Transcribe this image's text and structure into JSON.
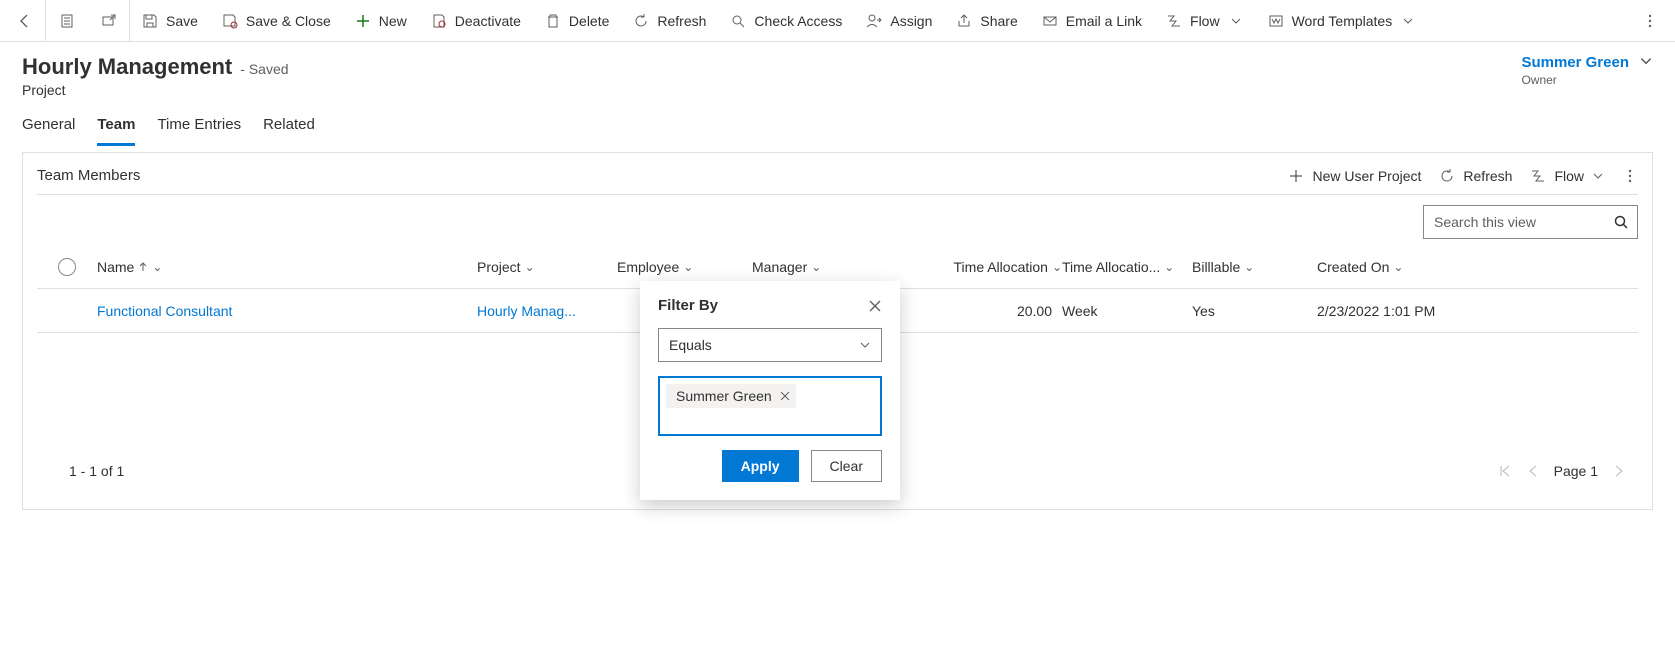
{
  "commandBar": {
    "save": "Save",
    "saveClose": "Save & Close",
    "new": "New",
    "deactivate": "Deactivate",
    "delete": "Delete",
    "refresh": "Refresh",
    "checkAccess": "Check Access",
    "assign": "Assign",
    "share": "Share",
    "emailLink": "Email a Link",
    "flow": "Flow",
    "wordTemplates": "Word Templates"
  },
  "header": {
    "title": "Hourly Management",
    "savedState": "- Saved",
    "entity": "Project",
    "ownerName": "Summer Green",
    "ownerLabel": "Owner"
  },
  "tabs": {
    "general": "General",
    "team": "Team",
    "timeEntries": "Time Entries",
    "related": "Related"
  },
  "subgrid": {
    "title": "Team Members",
    "actions": {
      "newUserProject": "New User Project",
      "refresh": "Refresh",
      "flow": "Flow"
    },
    "searchPlaceholder": "Search this view",
    "columns": {
      "name": "Name",
      "project": "Project",
      "employee": "Employee",
      "manager": "Manager",
      "timeAllocation": "Time Allocation",
      "timeAllocationUnit": "Time Allocatio...",
      "billable": "Billlable",
      "createdOn": "Created On"
    },
    "rows": [
      {
        "name": "Functional Consultant",
        "project": "Hourly Manag...",
        "employee": "",
        "manager": "",
        "timeAllocation": "20.00",
        "timeAllocationUnit": "Week",
        "billable": "Yes",
        "createdOn": "2/23/2022 1:01 PM"
      }
    ],
    "paging": {
      "range": "1 - 1 of 1",
      "pageLabel": "Page 1"
    }
  },
  "filterPopup": {
    "title": "Filter By",
    "operator": "Equals",
    "tagValue": "Summer Green",
    "apply": "Apply",
    "clear": "Clear"
  }
}
